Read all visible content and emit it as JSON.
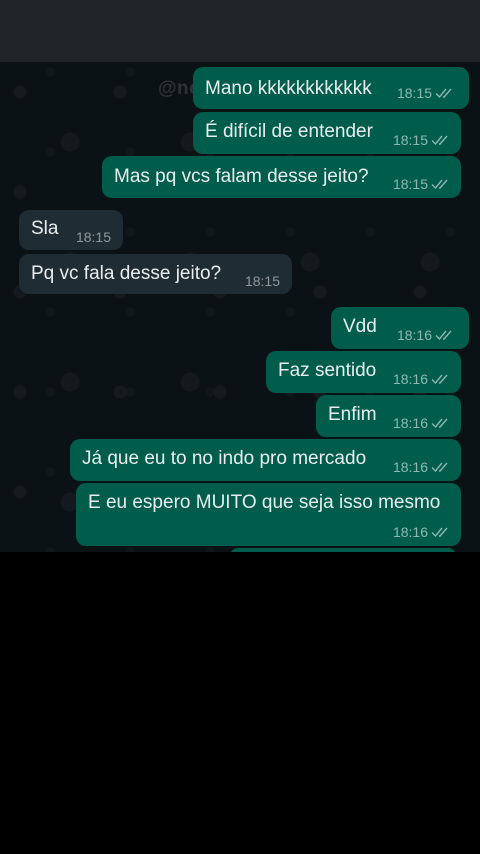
{
  "watermark": "@ne",
  "messages": [
    {
      "text": "Mano kkkkkkkkkkkk",
      "time": "18:15",
      "dir": "out"
    },
    {
      "text": "É difícil de entender",
      "time": "18:15",
      "dir": "out"
    },
    {
      "text": "Mas pq vcs falam desse jeito?",
      "time": "18:15",
      "dir": "out"
    },
    {
      "text": "Sla",
      "time": "18:15",
      "dir": "in"
    },
    {
      "text": "Pq vc fala desse jeito?",
      "time": "18:15",
      "dir": "in"
    },
    {
      "text": "Vdd",
      "time": "18:16",
      "dir": "out"
    },
    {
      "text": "Faz sentido",
      "time": "18:16",
      "dir": "out"
    },
    {
      "text": "Enfim",
      "time": "18:16",
      "dir": "out"
    },
    {
      "text": "Já que eu to no indo pro mercado",
      "time": "18:16",
      "dir": "out"
    },
    {
      "text": "E eu espero MUITO que seja isso mesmo",
      "time": "18:16",
      "dir": "out"
    }
  ],
  "colors": {
    "outgoing_bubble": "#005c4b",
    "incoming_bubble": "#1f2c34",
    "background": "#0b1216"
  },
  "icons": {
    "read_receipt": "double-check-icon"
  }
}
